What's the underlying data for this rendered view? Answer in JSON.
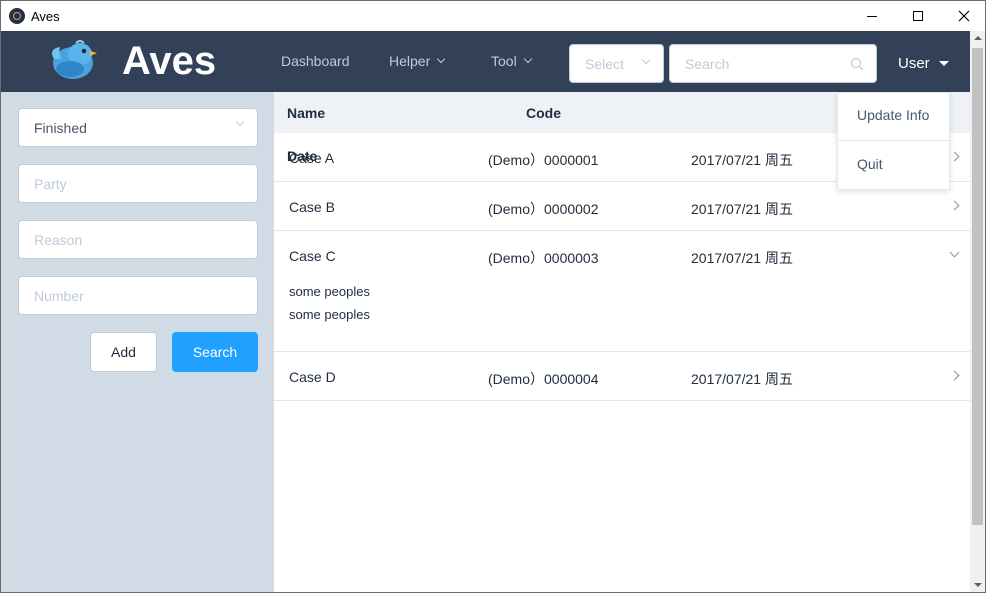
{
  "window": {
    "title": "Aves"
  },
  "header": {
    "brand": "Aves",
    "nav": [
      {
        "label": "Dashboard",
        "has_dropdown": false
      },
      {
        "label": "Helper",
        "has_dropdown": true
      },
      {
        "label": "Tool",
        "has_dropdown": true
      }
    ],
    "select_placeholder": "Select",
    "search_placeholder": "Search",
    "user_label": "User"
  },
  "user_menu": {
    "items": [
      "Update Info",
      "Quit"
    ]
  },
  "sidebar": {
    "status_value": "Finished",
    "party_placeholder": "Party",
    "reason_placeholder": "Reason",
    "number_placeholder": "Number",
    "add_label": "Add",
    "search_label": "Search"
  },
  "table": {
    "headers": {
      "name": "Name",
      "code": "Code",
      "date": "Date"
    },
    "rows": [
      {
        "name": "Case A",
        "code": "(Demo）0000001",
        "date": "2017/07/21 周五",
        "expanded": false
      },
      {
        "name": "Case B",
        "code": "(Demo）0000002",
        "date": "2017/07/21 周五",
        "expanded": false
      },
      {
        "name": "Case C",
        "code": "(Demo）0000003",
        "date": "2017/07/21 周五",
        "expanded": true,
        "details": [
          "some peoples",
          "some peoples"
        ]
      },
      {
        "name": "Case D",
        "code": "(Demo）0000004",
        "date": "2017/07/21 周五",
        "expanded": false
      }
    ]
  },
  "colors": {
    "header_bg": "#324157",
    "sidebar_bg": "#d1dbe5",
    "primary": "#20a0ff",
    "table_head_bg": "#eef1f6"
  },
  "icons": [
    "bird-logo-icon",
    "search-icon",
    "chevron-down-icon",
    "chevron-right-icon",
    "caret-down-icon"
  ]
}
